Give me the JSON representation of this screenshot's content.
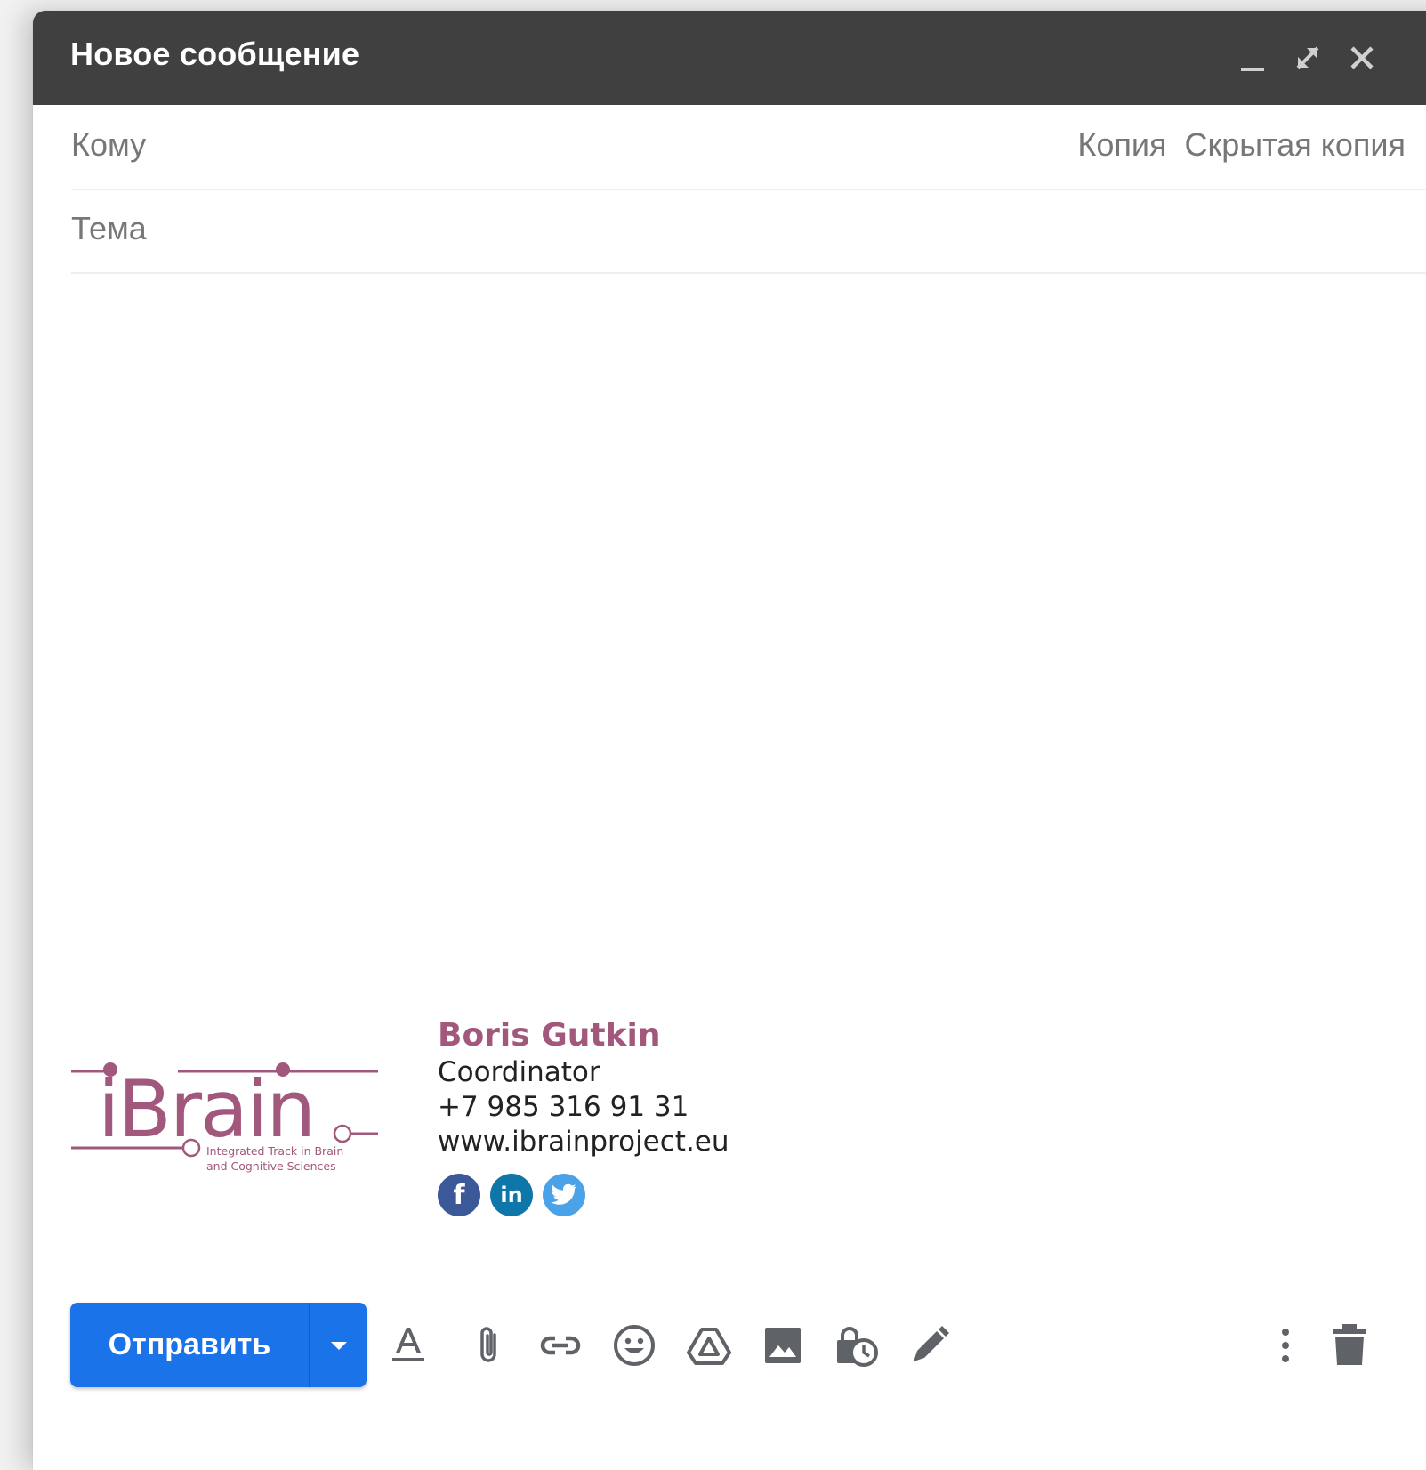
{
  "window": {
    "title": "Новое сообщение",
    "minimize_icon": "minimize-icon",
    "expand_icon": "expand-icon",
    "close_icon": "close-icon"
  },
  "fields": {
    "to_label": "Кому",
    "to_value": "",
    "cc_label": "Копия",
    "bcc_label": "Скрытая копия",
    "subject_label": "Тема",
    "subject_value": ""
  },
  "body": {
    "text": ""
  },
  "signature": {
    "logo_text": "iBrain",
    "logo_tagline_1": "Integrated Track in Brain",
    "logo_tagline_2": "and Cognitive Sciences",
    "name": "Boris Gutkin",
    "role": "Coordinator",
    "phone": "+7 985 316 91 31",
    "website": "www.ibrainproject.eu",
    "social": [
      {
        "icon": "facebook-icon",
        "glyph": "f",
        "color": "#3b5998"
      },
      {
        "icon": "linkedin-icon",
        "glyph": "in",
        "color": "#0e76a8"
      },
      {
        "icon": "twitter-icon",
        "glyph": "",
        "color": "#4aa3e8"
      }
    ],
    "accent_color": "#a1587c"
  },
  "toolbar": {
    "send_label": "Отправить",
    "send_color": "#1a73e8",
    "icons": [
      "text-format-icon",
      "attach-icon",
      "link-icon",
      "emoji-icon",
      "drive-icon",
      "image-icon",
      "confidential-icon",
      "signature-icon",
      "more-options-icon",
      "delete-icon"
    ]
  }
}
